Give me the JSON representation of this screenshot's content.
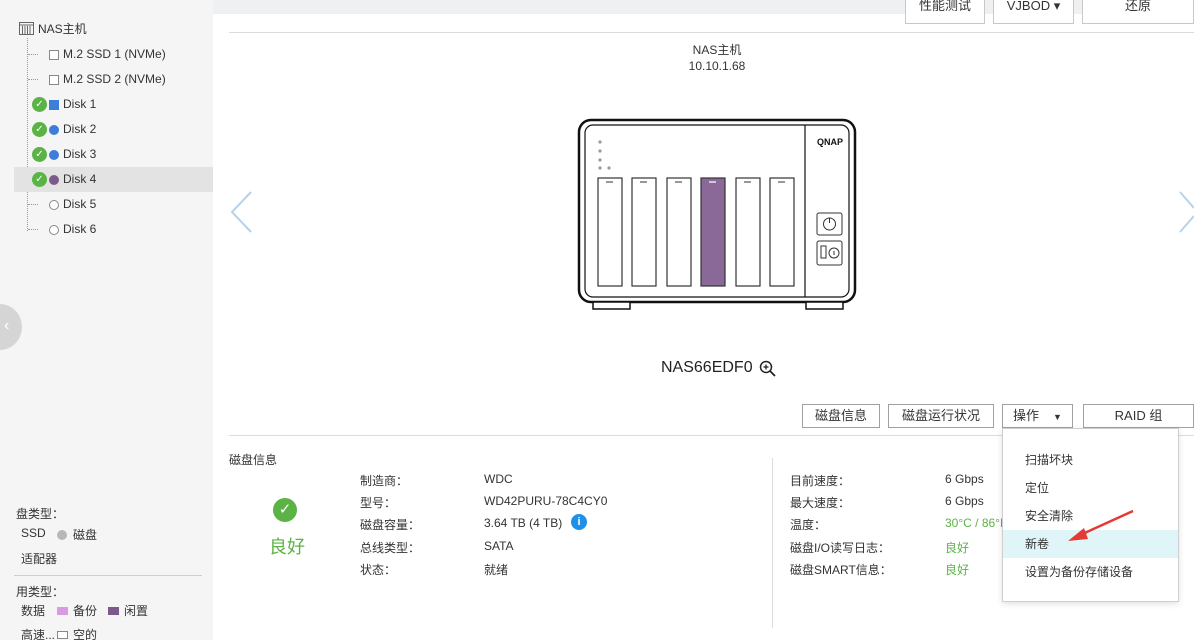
{
  "top_toolbar": {
    "perf_test_label": "性能测试",
    "vjbod_label": "VJBOD",
    "restore_label": "还原"
  },
  "sidebar": {
    "root_label": "NAS主机",
    "items": [
      {
        "label": "M.2 SSD 1 (NVMe)",
        "checked": false,
        "marker": "square-empty"
      },
      {
        "label": "M.2 SSD 2 (NVMe)",
        "checked": false,
        "marker": "square-empty"
      },
      {
        "label": "Disk 1",
        "checked": true,
        "marker": "square-blue"
      },
      {
        "label": "Disk 2",
        "checked": true,
        "marker": "dot-blue"
      },
      {
        "label": "Disk 3",
        "checked": true,
        "marker": "dot-blue"
      },
      {
        "label": "Disk 4",
        "checked": true,
        "marker": "dot-purple",
        "selected": true
      },
      {
        "label": "Disk 5",
        "checked": false,
        "marker": "dot-empty"
      },
      {
        "label": "Disk 6",
        "checked": false,
        "marker": "dot-empty"
      }
    ]
  },
  "legend": {
    "disk_type_title": "盘类型：",
    "ssd_label": "SSD",
    "hdd_label": "磁盘",
    "adapter_label": "适配器",
    "usage_type_title": "用类型：",
    "data_label": "数据",
    "backup_label": "备份",
    "idle_label": "闲置",
    "cache_label": "高速...",
    "empty_label": "空的"
  },
  "nas": {
    "title": "NAS主机",
    "ip": "10.10.1.68",
    "device_name": "NAS66EDF0",
    "brand": "QNAP",
    "selected_bay": 4
  },
  "actions": {
    "disk_info_label": "磁盘信息",
    "disk_health_label": "磁盘运行状况",
    "operation_label": "操作",
    "raid_label": "RAID 组"
  },
  "disk_info": {
    "section_title": "磁盘信息",
    "status": "良好",
    "left": [
      {
        "key": "制造商：",
        "value": "WDC"
      },
      {
        "key": "型号：",
        "value": "WD42PURU-78C4CY0"
      },
      {
        "key": "磁盘容量：",
        "value": "3.64 TB (4 TB)"
      },
      {
        "key": "总线类型：",
        "value": "SATA"
      },
      {
        "key": "状态：",
        "value": "就绪"
      }
    ],
    "right": [
      {
        "key": "目前速度：",
        "value": "6 Gbps"
      },
      {
        "key": "最大速度：",
        "value": "6 Gbps"
      },
      {
        "key": "温度：",
        "value": "30°C / 86°F"
      },
      {
        "key": "磁盘I/O读写日志：",
        "value": "良好"
      },
      {
        "key": "磁盘SMART信息：",
        "value": "良好"
      }
    ]
  },
  "operation_menu": {
    "items": [
      "扫描坏块",
      "定位",
      "安全清除",
      "新卷",
      "设置为备份存储设备"
    ],
    "highlighted_index": 3
  },
  "colors": {
    "ok_green": "#5bb346",
    "selected_bay_purple": "#8a6898",
    "annotation_red": "#e53935",
    "menu_hover": "#dff5f7"
  }
}
